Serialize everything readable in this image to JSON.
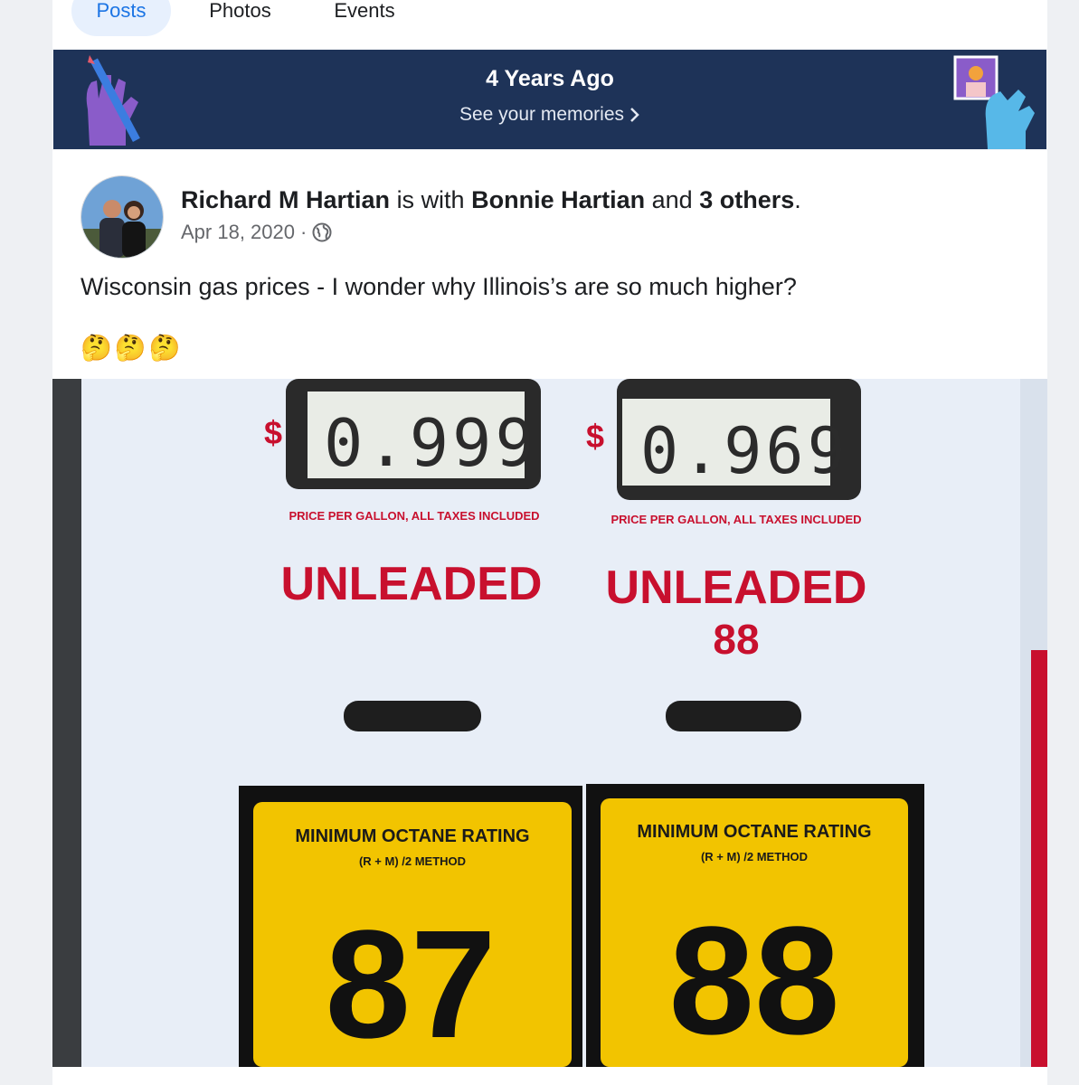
{
  "tabs": [
    {
      "label": "Posts",
      "active": true
    },
    {
      "label": "Photos",
      "active": false
    },
    {
      "label": "Events",
      "active": false
    }
  ],
  "memories": {
    "title": "4 Years Ago",
    "link": "See your memories"
  },
  "post": {
    "author": "Richard M Hartian",
    "with_text": "is with",
    "tagged": "Bonnie Hartian",
    "and_text": "and",
    "others": "3 others",
    "date": "Apr 18, 2020",
    "separator": "·",
    "privacy_icon": "globe-icon",
    "text": "Wisconsin gas prices - I wonder why Illinois’s are so much higher?",
    "emojis": "🤔🤔🤔"
  },
  "photo": {
    "left_pump": {
      "currency": "$",
      "price": "0.999",
      "price_note": "PRICE PER GALLON, ALL TAXES INCLUDED",
      "grade": "UNLEADED",
      "grade_number": "",
      "label_title": "MINIMUM OCTANE RATING",
      "label_method": "(R + M) /2 METHOD",
      "octane": "87"
    },
    "right_pump": {
      "currency": "$",
      "price": "0.969",
      "price_note": "PRICE PER GALLON, ALL TAXES INCLUDED",
      "grade": "UNLEADED",
      "grade_number": "88",
      "label_title": "MINIMUM OCTANE RATING",
      "label_method": "(R + M) /2 METHOD",
      "octane": "88"
    }
  },
  "colors": {
    "banner": "#1e3358",
    "accent": "#1b74e4",
    "pump_red": "#c8102e",
    "octane_yellow": "#f2c400"
  }
}
